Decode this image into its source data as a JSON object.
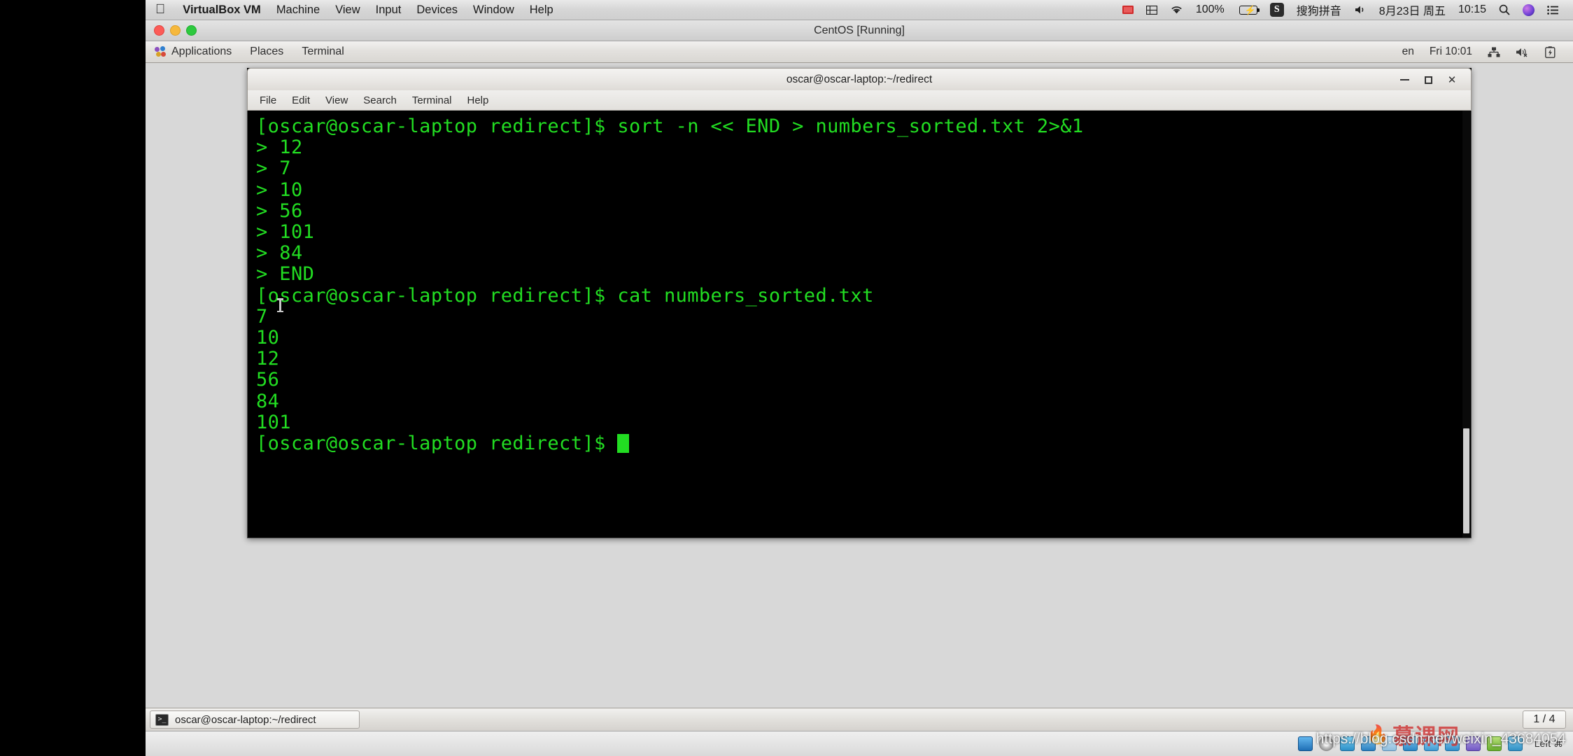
{
  "mac_menubar": {
    "apple_icon": "apple-icon",
    "items": [
      {
        "label": "VirtualBox VM",
        "bold": true
      },
      {
        "label": "Machine",
        "bold": false
      },
      {
        "label": "View",
        "bold": false
      },
      {
        "label": "Input",
        "bold": false
      },
      {
        "label": "Devices",
        "bold": false
      },
      {
        "label": "Window",
        "bold": false
      },
      {
        "label": "Help",
        "bold": false
      }
    ],
    "status": {
      "battery_percent": "100%",
      "input_method_icon": "S",
      "input_method": "搜狗拼音",
      "date": "8月23日 周五",
      "time": "10:15",
      "search_icon": "⌕",
      "siri_icon": "siri-icon",
      "control_center_icon": "☰"
    }
  },
  "vbox_window": {
    "title": "CentOS [Running]"
  },
  "gnome_panel": {
    "menus": [
      "Applications",
      "Places",
      "Terminal"
    ],
    "status": {
      "keyboard_layout": "en",
      "clock": "Fri 10:01",
      "network_icon": "network-icon",
      "volume_icon": "volume-muted-icon",
      "battery_icon": "battery-icon"
    }
  },
  "terminal": {
    "title": "oscar@oscar-laptop:~/redirect",
    "menus": [
      "File",
      "Edit",
      "View",
      "Search",
      "Terminal",
      "Help"
    ],
    "window_controls": [
      "minimize",
      "maximize",
      "close"
    ],
    "prompt": "[oscar@oscar-laptop redirect]$ ",
    "lines": [
      "[oscar@oscar-laptop redirect]$ sort -n << END > numbers_sorted.txt 2>&1",
      "> 12",
      "> 7",
      "> 10",
      "> 56",
      "> 101",
      "> 84",
      "> END",
      "[oscar@oscar-laptop redirect]$ cat numbers_sorted.txt",
      "7",
      "10",
      "12",
      "56",
      "84",
      "101"
    ],
    "last_prompt": "[oscar@oscar-laptop redirect]$ ",
    "colors": {
      "foreground": "#22dd22",
      "background": "#000000"
    }
  },
  "taskbar": {
    "window_button": "oscar@oscar-laptop:~/redirect",
    "workspace_indicator": "1 / 4"
  },
  "vbox_statusbar": {
    "host_key": "Left ⌘",
    "device_icons": [
      "hard-disk-icon",
      "optical-drive-icon",
      "floppy-icon",
      "network-icon",
      "usb-icon",
      "shared-folder-icon",
      "display-icon",
      "recording-icon",
      "vrde-icon",
      "guest-additions-icon",
      "share-icon"
    ]
  },
  "watermark": {
    "logo": "慕课网",
    "url": "https://blog.csdn.net/weixin_43684054"
  }
}
